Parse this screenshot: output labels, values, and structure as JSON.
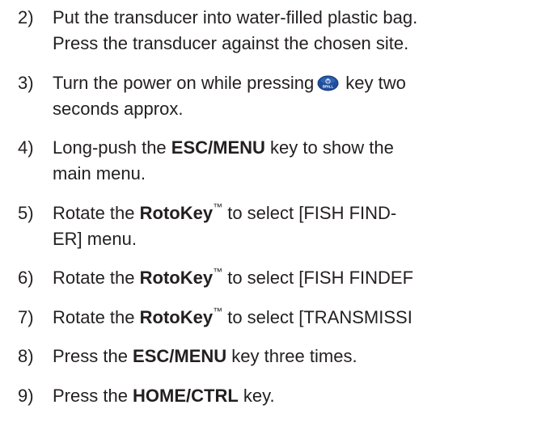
{
  "steps": [
    {
      "number": "2)",
      "line1": "Put the transducer into water-filled plastic bag.",
      "line2": "Press the transducer against the chosen site."
    },
    {
      "number": "3)",
      "line1_before": "Turn the power on while pressing",
      "key_icon": "brill-key-icon",
      "key_label": "BRILL",
      "line1_after": "key two",
      "line2": "seconds approx."
    },
    {
      "number": "4)",
      "line1_before": "Long-push the ",
      "key": "ESC/MENU",
      "line1_after": " key to show the",
      "line2": "main menu."
    },
    {
      "number": "5)",
      "line1_before": "Rotate the ",
      "key": "RotoKey",
      "tm": "™",
      "line1_after": " to select [FISH FIND-",
      "line2": "ER] menu."
    },
    {
      "number": "6)",
      "line1_before": "Rotate the ",
      "key": "RotoKey",
      "tm": "™",
      "line1_after": " to select [FISH FINDEF"
    },
    {
      "number": "7)",
      "line1_before": "Rotate the ",
      "key": "RotoKey",
      "tm": "™",
      "line1_after": " to select [TRANSMISSI"
    },
    {
      "number": "8)",
      "line1_before": "Press the ",
      "key": "ESC/MENU",
      "line1_after": " key three times."
    },
    {
      "number": "9)",
      "line1_before": "Press the ",
      "key": "HOME/CTRL",
      "line1_after": " key."
    }
  ],
  "colors": {
    "text": "#231f20",
    "key_fill": "#1f4e9c"
  }
}
